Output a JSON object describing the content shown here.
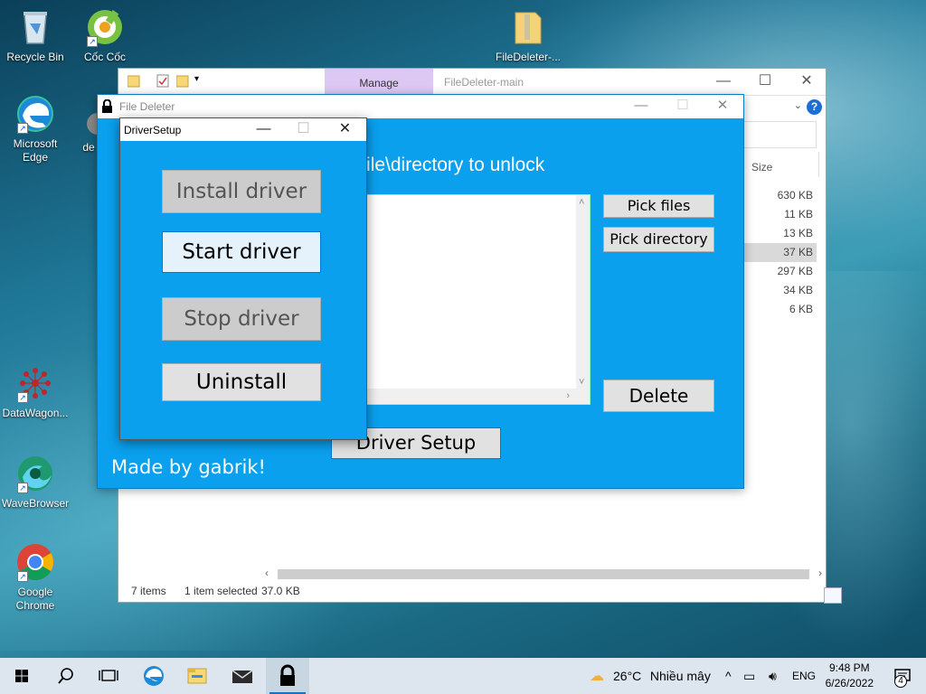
{
  "desktop": {
    "icons": [
      {
        "label": "Recycle Bin"
      },
      {
        "label": "Cốc Cốc"
      },
      {
        "label": "FileDeleter-..."
      },
      {
        "label": "Microsoft Edge"
      },
      {
        "label": "de"
      },
      {
        "label": "DataWagon..."
      },
      {
        "label": "WaveBrowser"
      },
      {
        "label": "Google Chrome"
      }
    ]
  },
  "explorer": {
    "manage_tab": "Manage",
    "title": "FileDeleter-main",
    "column_size": "Size",
    "sizes": [
      "630 KB",
      "11 KB",
      "13 KB",
      "37 KB",
      "297 KB",
      "34 KB",
      "6 KB"
    ],
    "selected_index": 3,
    "status_items": "7 items",
    "status_selected": "1 item selected",
    "status_size": "37.0 KB",
    "help": "?"
  },
  "file_deleter": {
    "title": "File Deleter",
    "heading": "he file\\directory to unlock",
    "pick_files": "Pick files",
    "pick_directory": "Pick directory",
    "delete": "Delete",
    "driver_setup": "Driver Setup",
    "made_by": "Made by gabrik!"
  },
  "driver_setup": {
    "title": "DriverSetup",
    "install": "Install driver",
    "start": "Start driver",
    "stop": "Stop driver",
    "uninstall": "Uninstall"
  },
  "taskbar": {
    "weather_temp": "26°C",
    "weather_text": "Nhiều mây",
    "language": "ENG",
    "time": "9:48 PM",
    "date": "6/26/2022",
    "notification_count": "4"
  },
  "colors": {
    "app_blue": "#0aa0ee",
    "manage_tab": "#dcc8f3"
  }
}
